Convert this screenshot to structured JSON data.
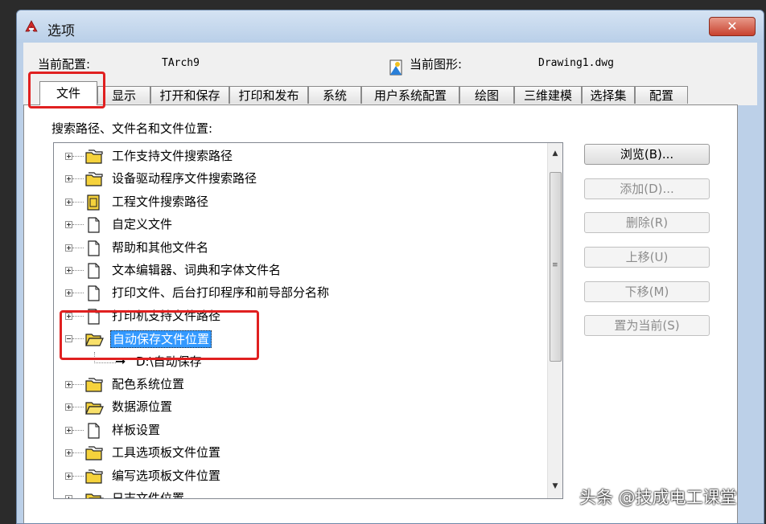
{
  "window": {
    "title": "选项",
    "close_symbol": "✕"
  },
  "info": {
    "current_profile_label": "当前配置:",
    "current_profile_value": "TArch9",
    "current_drawing_label": "当前图形:",
    "current_drawing_value": "Drawing1.dwg"
  },
  "tabs": [
    "文件",
    "显示",
    "打开和保存",
    "打印和发布",
    "系统",
    "用户系统配置",
    "绘图",
    "三维建模",
    "选择集",
    "配置"
  ],
  "panel": {
    "title": "搜索路径、文件名和文件位置:"
  },
  "tree": {
    "items": [
      {
        "label": "工作支持文件搜索路径",
        "icon": "folder-stack-icon"
      },
      {
        "label": "设备驱动程序文件搜索路径",
        "icon": "folder-stack-icon"
      },
      {
        "label": "工程文件搜索路径",
        "icon": "project-file-icon"
      },
      {
        "label": "自定义文件",
        "icon": "document-icon"
      },
      {
        "label": "帮助和其他文件名",
        "icon": "document-icon"
      },
      {
        "label": "文本编辑器、词典和字体文件名",
        "icon": "document-icon"
      },
      {
        "label": "打印文件、后台打印程序和前导部分名称",
        "icon": "document-icon"
      },
      {
        "label": "打印机支持文件路径",
        "icon": "document-icon"
      },
      {
        "label": "自动保存文件位置",
        "icon": "folder-open-icon",
        "selected": true
      },
      {
        "label": "D:\\自动保存",
        "icon": "arrow-right-icon",
        "child": true
      },
      {
        "label": "配色系统位置",
        "icon": "folder-stack-icon"
      },
      {
        "label": "数据源位置",
        "icon": "folder-open-icon"
      },
      {
        "label": "样板设置",
        "icon": "document-icon"
      },
      {
        "label": "工具选项板文件位置",
        "icon": "folder-stack-icon"
      },
      {
        "label": "编写选项板文件位置",
        "icon": "folder-stack-icon"
      },
      {
        "label": "日志文件位置",
        "icon": "folder-open-icon"
      }
    ]
  },
  "buttons": {
    "browse": "浏览(B)...",
    "add": "添加(D)...",
    "remove": "删除(R)",
    "move_up": "上移(U)",
    "move_down": "下移(M)",
    "set_current": "置为当前(S)"
  },
  "scrollbar": {
    "up": "▲",
    "down": "▼",
    "grip": "≡"
  },
  "watermark": {
    "text": "头条 @技成电工课堂"
  },
  "colors": {
    "highlight": "#e02020",
    "selection": "#3399ff",
    "folder": "#f5d23c"
  }
}
